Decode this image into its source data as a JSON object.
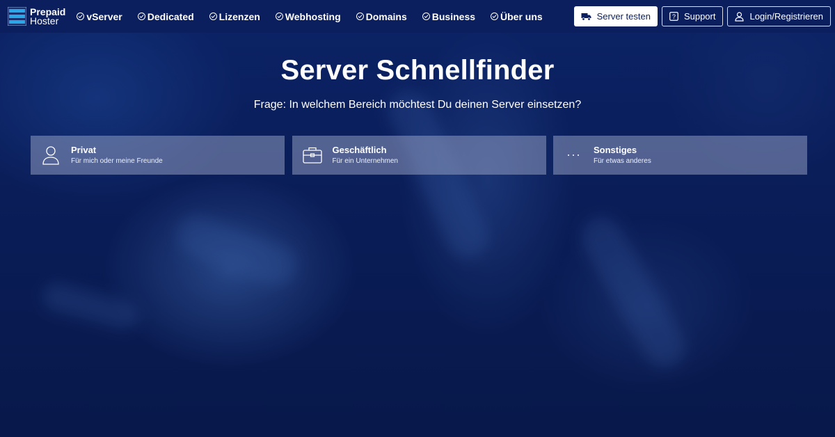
{
  "brand": {
    "line1": "Prepaid",
    "line2": "Hoster"
  },
  "nav": [
    {
      "label": "vServer"
    },
    {
      "label": "Dedicated"
    },
    {
      "label": "Lizenzen"
    },
    {
      "label": "Webhosting"
    },
    {
      "label": "Domains"
    },
    {
      "label": "Business"
    },
    {
      "label": "Über uns"
    }
  ],
  "actions": {
    "test_label": "Server testen",
    "support_label": "Support",
    "login_label": "Login/Registrieren"
  },
  "hero": {
    "title": "Server Schnellfinder",
    "question": "Frage: In welchem Bereich möchtest Du deinen Server einsetzen?"
  },
  "options": [
    {
      "title": "Privat",
      "desc": "Für mich oder meine Freunde",
      "icon": "user-icon"
    },
    {
      "title": "Geschäftlich",
      "desc": "Für ein Unternehmen",
      "icon": "briefcase-icon"
    },
    {
      "title": "Sonstiges",
      "desc": "Für etwas anderes",
      "icon": "more-icon"
    }
  ],
  "colors": {
    "navbar": "#0b1f5f",
    "background": "#0a1f5e",
    "card": "rgba(170,180,210,0.45)",
    "logo_accent": "#2aa7e6"
  }
}
